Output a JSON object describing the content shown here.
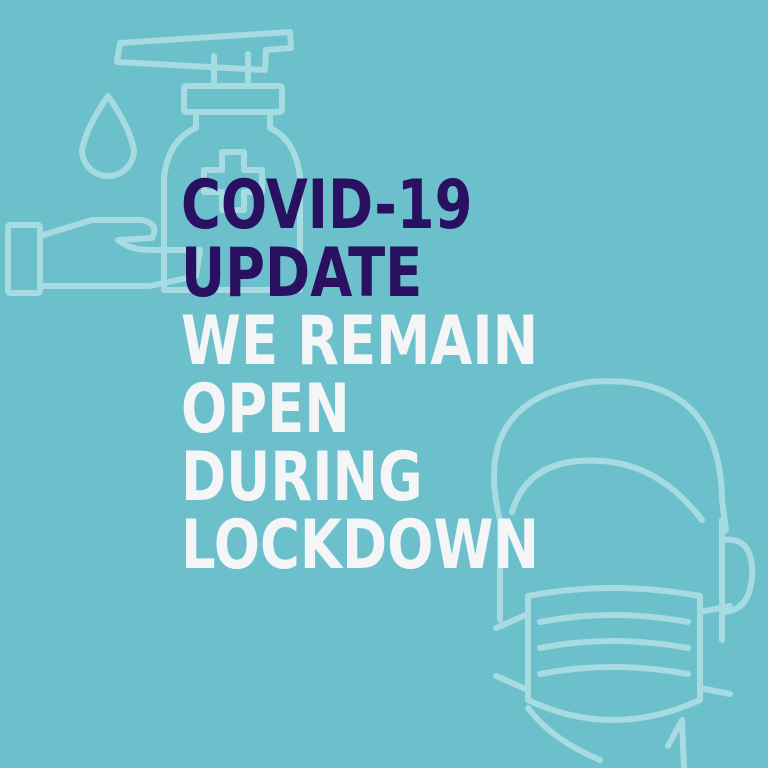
{
  "colors": {
    "background": "#6bc0cb",
    "outline_icons": "#a6dbe2",
    "headline_dark": "#2a1060",
    "headline_light": "#f4f5f6"
  },
  "icons": [
    "hand-sanitizer-icon",
    "water-drop-icon",
    "open-hand-icon",
    "face-mask-person-icon"
  ],
  "headline": {
    "line1": "COVID-19",
    "line2": "UPDATE"
  },
  "message": {
    "line1": "WE REMAIN",
    "line2": "OPEN",
    "line3": "DURING",
    "line4": "LOCKDOWN"
  }
}
